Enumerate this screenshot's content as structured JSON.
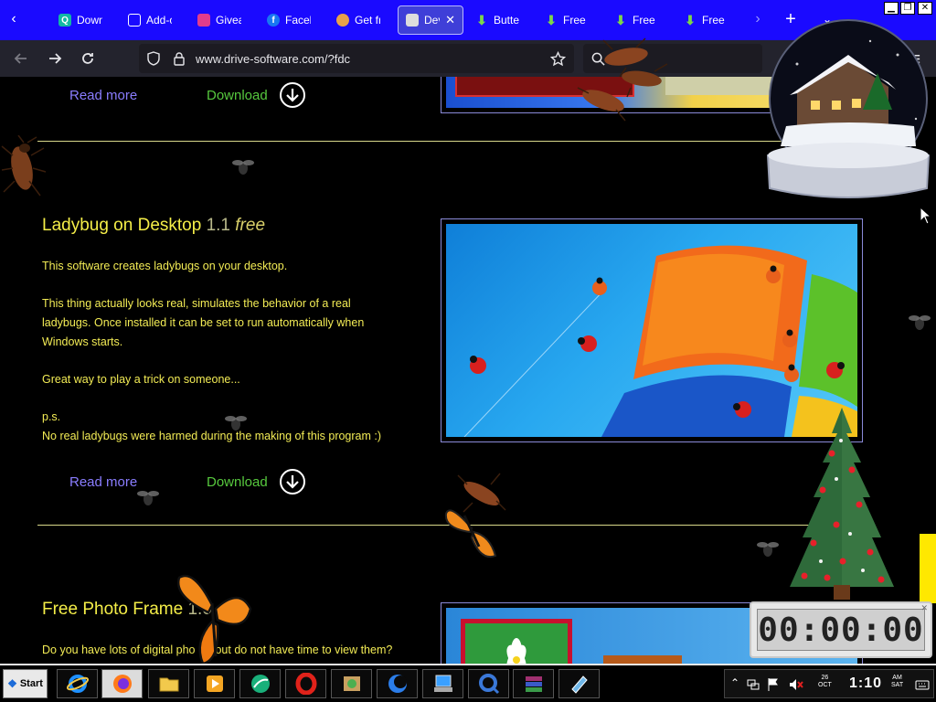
{
  "browser": {
    "tabs": [
      {
        "label": "Downl",
        "icon": "search-icon",
        "active": false
      },
      {
        "label": "Add-o",
        "icon": "puzzle-icon",
        "active": false
      },
      {
        "label": "Givea",
        "icon": "gift-icon",
        "active": false
      },
      {
        "label": "Faceb",
        "icon": "facebook-icon",
        "active": false
      },
      {
        "label": "Get fr",
        "icon": "figure-icon",
        "active": false
      },
      {
        "label": "Dev",
        "icon": "clapper-icon",
        "active": true
      },
      {
        "label": "Butterf",
        "icon": "download-arrow-icon",
        "active": false
      },
      {
        "label": "Free s",
        "icon": "download-arrow-icon",
        "active": false
      },
      {
        "label": "Free s",
        "icon": "download-arrow-icon",
        "active": false
      },
      {
        "label": "Free s",
        "icon": "download-arrow-icon",
        "active": false
      }
    ],
    "url": "www.drive-software.com/?fdc"
  },
  "page": {
    "prev_section": {
      "read_more": "Read more",
      "download": "Download"
    },
    "ladybug": {
      "title": "Ladybug on Desktop",
      "version": "1.1",
      "free": "free",
      "paragraphs": [
        "This software creates ladybugs on your desktop.",
        "This thing actually looks real, simulates the behavior of a real",
        "ladybugs. Once installed it can be set to run automatically when",
        "Windows starts.",
        "Great way to play a trick on someone...",
        "p.s.",
        "No real ladybugs were harmed during the making of this program :)"
      ],
      "read_more": "Read more",
      "download": "Download"
    },
    "photo_frame": {
      "title": "Free Photo Frame",
      "version": "1.0",
      "free": "free",
      "intro": "Do you have lots of digital pho",
      "intro_rest": "out do not have time to view them?"
    }
  },
  "overlay": {
    "timer": "00:00:00"
  },
  "taskbar": {
    "start_label": "Start",
    "items": [
      {
        "name": "internet-explorer-icon",
        "color": "#1e90ff"
      },
      {
        "name": "firefox-icon",
        "color": "#ff7a1a"
      },
      {
        "name": "folder-icon",
        "color": "#f2c94c"
      },
      {
        "name": "media-player-icon",
        "color": "#f5a623"
      },
      {
        "name": "globe-app-icon",
        "color": "#19b07a"
      },
      {
        "name": "opera-icon",
        "color": "#e0221a"
      },
      {
        "name": "package-icon",
        "color": "#4caf50"
      },
      {
        "name": "moon-app-icon",
        "color": "#2b7de9"
      },
      {
        "name": "network-app-icon",
        "color": "#3aa0ff"
      },
      {
        "name": "search-app-icon",
        "color": "#3a78d8"
      },
      {
        "name": "archive-icon",
        "color": "#a03070"
      },
      {
        "name": "notepad-icon",
        "color": "#6fb7e8"
      }
    ],
    "tray": {
      "date_day": "26",
      "date_month": "OCT",
      "time": "1:10",
      "ampm": "AM",
      "weekday": "SAT"
    }
  },
  "colors": {
    "tab_strip": "#1a0aff",
    "heading": "#f5ee48",
    "body_text": "#f3ec55",
    "read_more": "#8a7dff",
    "download": "#57c93e"
  }
}
